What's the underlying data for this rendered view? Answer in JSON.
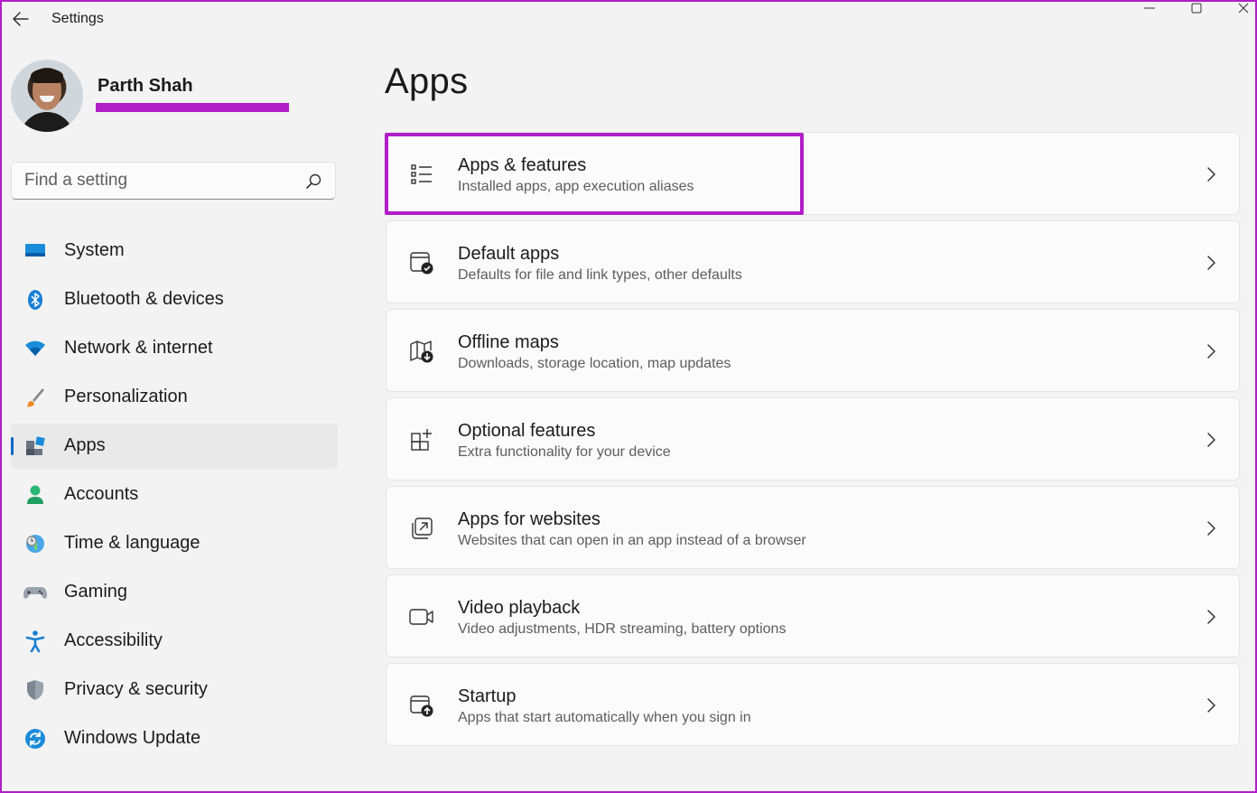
{
  "window": {
    "title": "Settings",
    "controls": [
      "minimize-icon",
      "maximize-icon",
      "close-icon"
    ]
  },
  "profile": {
    "name": "Parth Shah"
  },
  "search": {
    "placeholder": "Find a setting"
  },
  "sidebar": {
    "items": [
      {
        "label": "System",
        "icon": "system-icon"
      },
      {
        "label": "Bluetooth & devices",
        "icon": "bluetooth-icon"
      },
      {
        "label": "Network & internet",
        "icon": "wifi-icon"
      },
      {
        "label": "Personalization",
        "icon": "brush-icon"
      },
      {
        "label": "Apps",
        "icon": "apps-icon",
        "selected": true
      },
      {
        "label": "Accounts",
        "icon": "person-icon"
      },
      {
        "label": "Time & language",
        "icon": "globe-clock-icon"
      },
      {
        "label": "Gaming",
        "icon": "gamepad-icon"
      },
      {
        "label": "Accessibility",
        "icon": "accessibility-icon"
      },
      {
        "label": "Privacy & security",
        "icon": "shield-icon"
      },
      {
        "label": "Windows Update",
        "icon": "refresh-icon"
      }
    ]
  },
  "main": {
    "title": "Apps",
    "cards": [
      {
        "title": "Apps & features",
        "subtitle": "Installed apps, app execution aliases",
        "icon": "list-icon",
        "highlighted": true
      },
      {
        "title": "Default apps",
        "subtitle": "Defaults for file and link types, other defaults",
        "icon": "default-apps-icon"
      },
      {
        "title": "Offline maps",
        "subtitle": "Downloads, storage location, map updates",
        "icon": "map-download-icon"
      },
      {
        "title": "Optional features",
        "subtitle": "Extra functionality for your device",
        "icon": "add-feature-icon"
      },
      {
        "title": "Apps for websites",
        "subtitle": "Websites that can open in an app instead of a browser",
        "icon": "open-external-icon"
      },
      {
        "title": "Video playback",
        "subtitle": "Video adjustments, HDR streaming, battery options",
        "icon": "video-icon"
      },
      {
        "title": "Startup",
        "subtitle": "Apps that start automatically when you sign in",
        "icon": "startup-icon"
      }
    ]
  },
  "colors": {
    "accent": "#0067c0",
    "annotation": "#b01ec8",
    "background": "#f3f3f3",
    "card": "#fbfbfb"
  }
}
